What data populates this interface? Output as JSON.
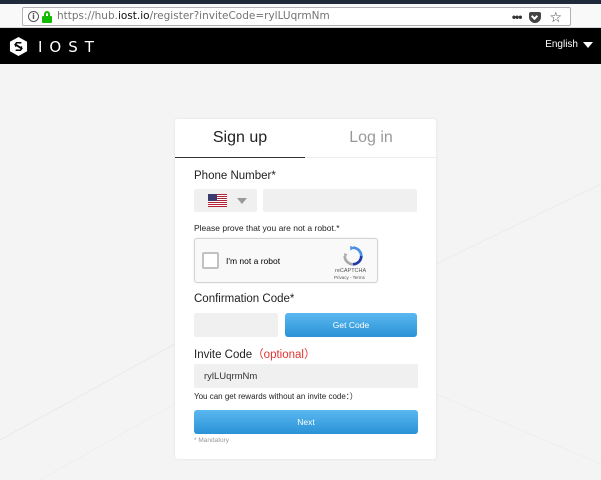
{
  "browser": {
    "url_prefix": "https://hub.",
    "url_domain": "iost.io",
    "url_path": "/register?inviteCode=rylLUqrmNm",
    "info_glyph": "i",
    "menu_glyph": "•••",
    "star_glyph": "☆"
  },
  "header": {
    "logo_text": "IOST",
    "language": "English"
  },
  "tabs": {
    "signup": "Sign up",
    "login": "Log in"
  },
  "form": {
    "phone_label": "Phone Number*",
    "country_selected": "United States",
    "phone_value": "",
    "robot_prompt": "Please prove that you are not a robot.*",
    "recaptcha_label": "I'm not a robot",
    "recaptcha_brand": "reCAPTCHA",
    "recaptcha_links": "Privacy - Terms",
    "confirmation_label": "Confirmation Code*",
    "confirmation_value": "",
    "get_code_button": "Get Code",
    "invite_label": "Invite Code",
    "invite_optional": "（optional）",
    "invite_value": "rylLUqrmNm",
    "invite_hint": "You can get rewards without an invite code：）",
    "next_button": "Next",
    "mandatory_note": "* Mandatory"
  },
  "colors": {
    "primary_button": "#2a92d6",
    "optional_text": "#e23333",
    "header_bg": "#000000",
    "lock_green": "#12bc00"
  },
  "icons": {
    "lock": "lock-icon",
    "info": "info-icon",
    "pocket": "pocket-icon",
    "star": "star-icon",
    "flag": "us-flag-icon",
    "recaptcha": "recaptcha-logo-icon"
  }
}
